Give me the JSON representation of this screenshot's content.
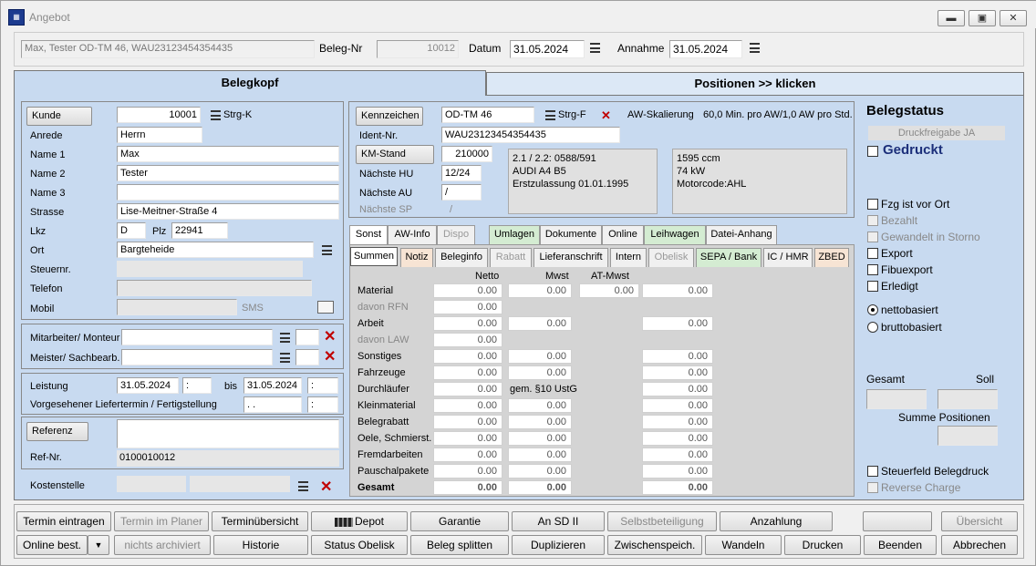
{
  "window": {
    "title": "Angebot"
  },
  "header": {
    "customer_line": "Max, Tester OD-TM 46, WAU23123454354435",
    "beleg_nr_label": "Beleg-Nr",
    "beleg_nr": "10012",
    "datum_label": "Datum",
    "datum": "31.05.2024",
    "annahme_label": "Annahme",
    "annahme": "31.05.2024"
  },
  "main_tabs": {
    "belegkopf": "Belegkopf",
    "positionen": "Positionen >> klicken"
  },
  "kunde": {
    "kunde_label": "Kunde",
    "kunde_nr": "10001",
    "strg_k": "Strg-K",
    "anrede_label": "Anrede",
    "anrede": "Herrn",
    "name1_label": "Name 1",
    "name1": "Max",
    "name2_label": "Name 2",
    "name2": "Tester",
    "name3_label": "Name 3",
    "name3": "",
    "strasse_label": "Strasse",
    "strasse": "Lise-Meitner-Straße 4",
    "lkz_label": "Lkz",
    "lkz": "D",
    "plz_label": "Plz",
    "plz": "22941",
    "ort_label": "Ort",
    "ort": "Bargteheide",
    "steuernr_label": "Steuernr.",
    "telefon_label": "Telefon",
    "mobil_label": "Mobil",
    "sms": "SMS"
  },
  "mitarbeiter": {
    "monteur_label": "Mitarbeiter/ Monteur",
    "meister_label": "Meister/ Sachbearb."
  },
  "leistung": {
    "label": "Leistung",
    "von": "31.05.2024",
    "von_time": ":",
    "bis_label": "bis",
    "bis": "31.05.2024",
    "bis_time": ":",
    "liefertermin_label": "Vorgesehener Liefertermin / Fertigstellung",
    "liefer_date": ". .",
    "liefer_time": ":"
  },
  "referenz": {
    "label": "Referenz",
    "refnr_label": "Ref-Nr.",
    "refnr": "0100010012",
    "kostenstelle_label": "Kostenstelle"
  },
  "fahrzeug": {
    "kennzeichen_label": "Kennzeichen",
    "kennzeichen": "OD-TM 46",
    "strg_f": "Strg-F",
    "aw_skalierung_label": "AW-Skalierung",
    "aw_skalierung": "60,0 Min. pro AW/1,0 AW pro Std.",
    "ident_label": "Ident-Nr.",
    "ident": "WAU23123454354435",
    "km_label": "KM-Stand",
    "km": "210000",
    "hu_label": "Nächste HU",
    "hu": "12/24",
    "au_label": "Nächste AU",
    "au": "/",
    "sp_label": "Nächste SP",
    "sp": "/",
    "info1": [
      "2.1 / 2.2: 0588/591",
      "AUDI A4 B5",
      "Erstzulassung 01.01.1995"
    ],
    "info2": [
      "1595 ccm",
      "74 kW",
      "Motorcode:AHL"
    ]
  },
  "tabs_row1": [
    "Sonst",
    "AW-Info",
    "Dispo",
    "Umlagen",
    "Dokumente",
    "Online",
    "Leihwagen",
    "Datei-Anhang"
  ],
  "tabs_row2": [
    "Summen",
    "Notiz",
    "Beleginfo",
    "Rabatt",
    "Lieferanschrift",
    "Intern",
    "Obelisk",
    "SEPA / Bank",
    "IC / HMR",
    "ZBED"
  ],
  "summen": {
    "col_netto": "Netto",
    "col_mwst": "Mwst",
    "col_at_mwst": "AT-Mwst",
    "rows": [
      {
        "label": "Material",
        "netto": "0.00",
        "mwst": "0.00",
        "at": "0.00",
        "total": "0.00"
      },
      {
        "label": "davon RFN",
        "netto": "0.00",
        "mwst": "",
        "at": "",
        "total": ""
      },
      {
        "label": "Arbeit",
        "netto": "0.00",
        "mwst": "0.00",
        "at": "",
        "total": "0.00"
      },
      {
        "label": "davon LAW",
        "netto": "0.00",
        "mwst": "",
        "at": "",
        "total": ""
      },
      {
        "label": "Sonstiges",
        "netto": "0.00",
        "mwst": "0.00",
        "at": "",
        "total": "0.00"
      },
      {
        "label": "Fahrzeuge",
        "netto": "0.00",
        "mwst": "0.00",
        "at": "",
        "total": "0.00"
      },
      {
        "label": "Durchläufer",
        "netto": "0.00",
        "mwst": "gem. §10 UstG",
        "at": "",
        "total": "0.00"
      },
      {
        "label": "Kleinmaterial",
        "netto": "0.00",
        "mwst": "0.00",
        "at": "",
        "total": "0.00"
      },
      {
        "label": "Belegrabatt",
        "netto": "0.00",
        "mwst": "0.00",
        "at": "",
        "total": "0.00"
      },
      {
        "label": "Oele, Schmierst.",
        "netto": "0.00",
        "mwst": "0.00",
        "at": "",
        "total": "0.00"
      },
      {
        "label": "Fremdarbeiten",
        "netto": "0.00",
        "mwst": "0.00",
        "at": "",
        "total": "0.00"
      },
      {
        "label": "Pauschalpakete",
        "netto": "0.00",
        "mwst": "0.00",
        "at": "",
        "total": "0.00"
      },
      {
        "label": "Gesamt",
        "netto": "0.00",
        "mwst": "0.00",
        "at": "",
        "total": "0.00"
      }
    ]
  },
  "belegstatus": {
    "title": "Belegstatus",
    "druckfreigabe": "Druckfreigabe JA",
    "gedruckt": "Gedruckt",
    "checks": [
      "Fzg ist vor Ort",
      "Bezahlt",
      "Gewandelt in Storno",
      "Export",
      "Fibuexport",
      "Erledigt"
    ],
    "radio_netto": "nettobasiert",
    "radio_brutto": "bruttobasiert",
    "gesamt": "Gesamt",
    "soll": "Soll",
    "summe_positionen": "Summe Positionen",
    "steuerfeld": "Steuerfeld Belegdruck",
    "reverse_charge": "Reverse Charge"
  },
  "buttons_row1": [
    "Termin eintragen",
    "Termin im Planer",
    "Terminübersicht",
    "Depot",
    "Garantie",
    "An SD II",
    "Selbstbeteiligung",
    "Anzahlung",
    "",
    "Übersicht"
  ],
  "buttons_row2": [
    "Online best.",
    "nichts archiviert",
    "Historie",
    "Status Obelisk",
    "Beleg splitten",
    "Duplizieren",
    "Zwischenspeich.",
    "Wandeln",
    "Drucken",
    "Beenden",
    "Abbrechen"
  ]
}
